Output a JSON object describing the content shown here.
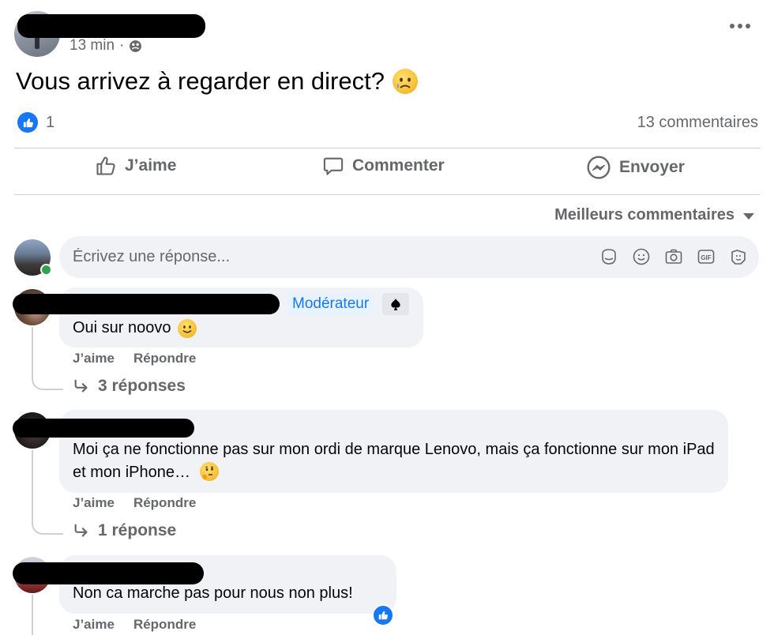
{
  "post": {
    "time": "13 min",
    "separator": "·",
    "text": "Vous arrivez à regarder en direct?",
    "like_count": "1",
    "comments_count": "13 commentaires"
  },
  "actions": {
    "like": "J’aime",
    "comment": "Commenter",
    "send": "Envoyer"
  },
  "sort_label": "Meilleurs commentaires",
  "reply_box": {
    "placeholder": "Écrivez une réponse..."
  },
  "comments": [
    {
      "badge": "Modérateur",
      "text": "Oui sur noovo",
      "like": "J’aime",
      "reply": "Répondre",
      "replies": "3 réponses"
    },
    {
      "text": "Moi ça ne fonctionne pas sur mon ordi de marque Lenovo, mais ça fonctionne sur mon iPad et mon iPhone…",
      "like": "J’aime",
      "reply": "Répondre",
      "replies": "1 réponse"
    },
    {
      "text": "Non ca marche pas pour nous non plus!",
      "like": "J’aime",
      "reply": "Répondre"
    }
  ],
  "colors": {
    "accent": "#1877f2",
    "muted_text": "#65676b",
    "bubble": "#f0f2f5",
    "online": "#31a24c"
  },
  "icons": [
    "globe-icon",
    "more-icon",
    "like-icon",
    "comment-icon",
    "messenger-icon",
    "sticker-icon",
    "emoji-icon",
    "camera-icon",
    "gif-icon",
    "avatar-sticker-icon",
    "reply-arrow-icon",
    "moderator-icon"
  ]
}
